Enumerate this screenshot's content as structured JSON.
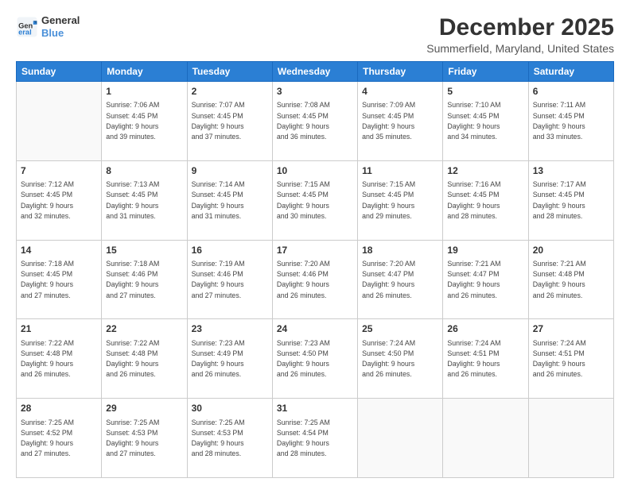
{
  "header": {
    "logo_text_general": "General",
    "logo_text_blue": "Blue",
    "main_title": "December 2025",
    "subtitle": "Summerfield, Maryland, United States"
  },
  "calendar": {
    "days_of_week": [
      "Sunday",
      "Monday",
      "Tuesday",
      "Wednesday",
      "Thursday",
      "Friday",
      "Saturday"
    ],
    "weeks": [
      [
        {
          "day": "",
          "info": ""
        },
        {
          "day": "1",
          "info": "Sunrise: 7:06 AM\nSunset: 4:45 PM\nDaylight: 9 hours\nand 39 minutes."
        },
        {
          "day": "2",
          "info": "Sunrise: 7:07 AM\nSunset: 4:45 PM\nDaylight: 9 hours\nand 37 minutes."
        },
        {
          "day": "3",
          "info": "Sunrise: 7:08 AM\nSunset: 4:45 PM\nDaylight: 9 hours\nand 36 minutes."
        },
        {
          "day": "4",
          "info": "Sunrise: 7:09 AM\nSunset: 4:45 PM\nDaylight: 9 hours\nand 35 minutes."
        },
        {
          "day": "5",
          "info": "Sunrise: 7:10 AM\nSunset: 4:45 PM\nDaylight: 9 hours\nand 34 minutes."
        },
        {
          "day": "6",
          "info": "Sunrise: 7:11 AM\nSunset: 4:45 PM\nDaylight: 9 hours\nand 33 minutes."
        }
      ],
      [
        {
          "day": "7",
          "info": "Sunrise: 7:12 AM\nSunset: 4:45 PM\nDaylight: 9 hours\nand 32 minutes."
        },
        {
          "day": "8",
          "info": "Sunrise: 7:13 AM\nSunset: 4:45 PM\nDaylight: 9 hours\nand 31 minutes."
        },
        {
          "day": "9",
          "info": "Sunrise: 7:14 AM\nSunset: 4:45 PM\nDaylight: 9 hours\nand 31 minutes."
        },
        {
          "day": "10",
          "info": "Sunrise: 7:15 AM\nSunset: 4:45 PM\nDaylight: 9 hours\nand 30 minutes."
        },
        {
          "day": "11",
          "info": "Sunrise: 7:15 AM\nSunset: 4:45 PM\nDaylight: 9 hours\nand 29 minutes."
        },
        {
          "day": "12",
          "info": "Sunrise: 7:16 AM\nSunset: 4:45 PM\nDaylight: 9 hours\nand 28 minutes."
        },
        {
          "day": "13",
          "info": "Sunrise: 7:17 AM\nSunset: 4:45 PM\nDaylight: 9 hours\nand 28 minutes."
        }
      ],
      [
        {
          "day": "14",
          "info": "Sunrise: 7:18 AM\nSunset: 4:45 PM\nDaylight: 9 hours\nand 27 minutes."
        },
        {
          "day": "15",
          "info": "Sunrise: 7:18 AM\nSunset: 4:46 PM\nDaylight: 9 hours\nand 27 minutes."
        },
        {
          "day": "16",
          "info": "Sunrise: 7:19 AM\nSunset: 4:46 PM\nDaylight: 9 hours\nand 27 minutes."
        },
        {
          "day": "17",
          "info": "Sunrise: 7:20 AM\nSunset: 4:46 PM\nDaylight: 9 hours\nand 26 minutes."
        },
        {
          "day": "18",
          "info": "Sunrise: 7:20 AM\nSunset: 4:47 PM\nDaylight: 9 hours\nand 26 minutes."
        },
        {
          "day": "19",
          "info": "Sunrise: 7:21 AM\nSunset: 4:47 PM\nDaylight: 9 hours\nand 26 minutes."
        },
        {
          "day": "20",
          "info": "Sunrise: 7:21 AM\nSunset: 4:48 PM\nDaylight: 9 hours\nand 26 minutes."
        }
      ],
      [
        {
          "day": "21",
          "info": "Sunrise: 7:22 AM\nSunset: 4:48 PM\nDaylight: 9 hours\nand 26 minutes."
        },
        {
          "day": "22",
          "info": "Sunrise: 7:22 AM\nSunset: 4:48 PM\nDaylight: 9 hours\nand 26 minutes."
        },
        {
          "day": "23",
          "info": "Sunrise: 7:23 AM\nSunset: 4:49 PM\nDaylight: 9 hours\nand 26 minutes."
        },
        {
          "day": "24",
          "info": "Sunrise: 7:23 AM\nSunset: 4:50 PM\nDaylight: 9 hours\nand 26 minutes."
        },
        {
          "day": "25",
          "info": "Sunrise: 7:24 AM\nSunset: 4:50 PM\nDaylight: 9 hours\nand 26 minutes."
        },
        {
          "day": "26",
          "info": "Sunrise: 7:24 AM\nSunset: 4:51 PM\nDaylight: 9 hours\nand 26 minutes."
        },
        {
          "day": "27",
          "info": "Sunrise: 7:24 AM\nSunset: 4:51 PM\nDaylight: 9 hours\nand 26 minutes."
        }
      ],
      [
        {
          "day": "28",
          "info": "Sunrise: 7:25 AM\nSunset: 4:52 PM\nDaylight: 9 hours\nand 27 minutes."
        },
        {
          "day": "29",
          "info": "Sunrise: 7:25 AM\nSunset: 4:53 PM\nDaylight: 9 hours\nand 27 minutes."
        },
        {
          "day": "30",
          "info": "Sunrise: 7:25 AM\nSunset: 4:53 PM\nDaylight: 9 hours\nand 28 minutes."
        },
        {
          "day": "31",
          "info": "Sunrise: 7:25 AM\nSunset: 4:54 PM\nDaylight: 9 hours\nand 28 minutes."
        },
        {
          "day": "",
          "info": ""
        },
        {
          "day": "",
          "info": ""
        },
        {
          "day": "",
          "info": ""
        }
      ]
    ]
  }
}
